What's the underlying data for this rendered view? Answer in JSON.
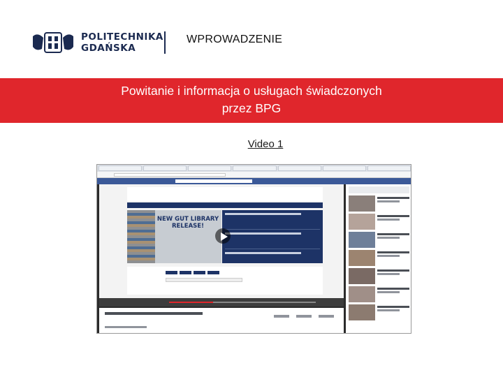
{
  "header": {
    "logo_line1": "POLITECHNIKA",
    "logo_line2": "GDAŃSKA",
    "section_title": "WPROWADZENIE"
  },
  "band": {
    "line1": "Powitanie i informacja o usługach świadczonych",
    "line2": "przez BPG"
  },
  "video_link": "Video 1",
  "embedded_banner": "NEW GUT LIBRARY RELEASE!",
  "colors": {
    "brand_navy": "#1b2a50",
    "band_red": "#e0262c",
    "facebook_blue": "#3b5998"
  }
}
